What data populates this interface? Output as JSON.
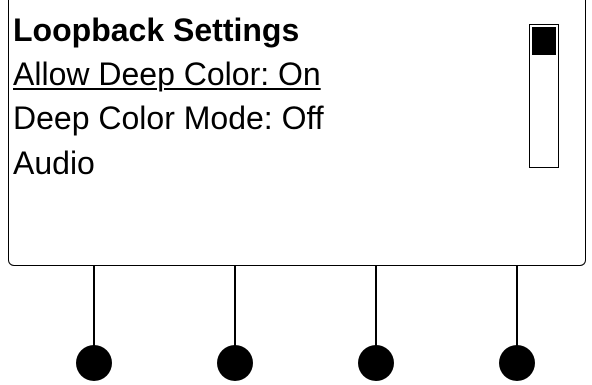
{
  "screen": {
    "title": "Loopback Settings",
    "menu_items": [
      {
        "label": "Allow Deep Color: On",
        "selected": true
      },
      {
        "label": "Deep Color Mode: Off",
        "selected": false
      },
      {
        "label": "Audio",
        "selected": false
      }
    ]
  },
  "softkeys": [
    {
      "name": "softkey-1"
    },
    {
      "name": "softkey-2"
    },
    {
      "name": "softkey-3"
    },
    {
      "name": "softkey-4"
    }
  ],
  "colors": {
    "foreground": "#000000",
    "background": "#ffffff"
  }
}
